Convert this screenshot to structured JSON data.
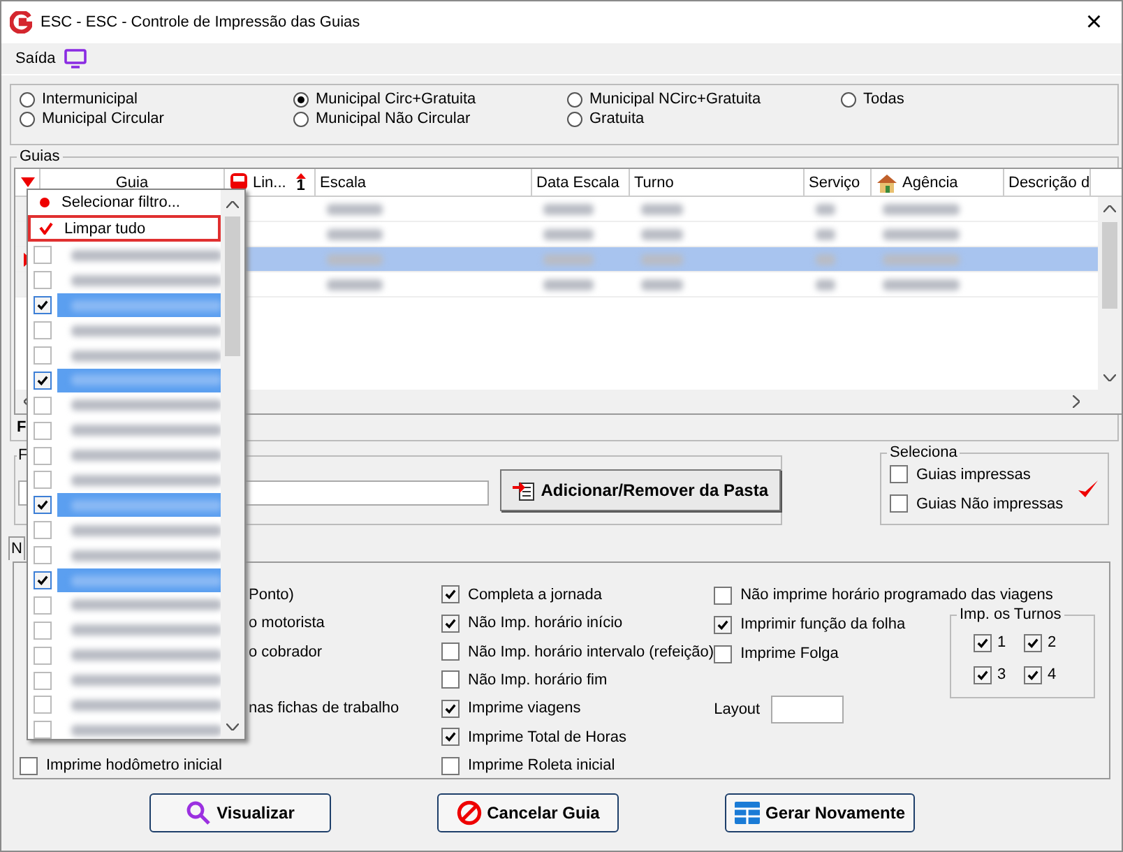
{
  "window": {
    "title": "ESC -  ESC - Controle de Impressão das Guias",
    "close": "×"
  },
  "menu": [
    {
      "label": "Saída",
      "kind": "monitor"
    }
  ],
  "line_types": [
    {
      "label": "Intermunicipal",
      "selected": false
    },
    {
      "label": "Municipal Circular",
      "selected": false
    },
    {
      "label": "Municipal Circ+Gratuita",
      "selected": true
    },
    {
      "label": "Municipal Não Circular",
      "selected": false
    },
    {
      "label": "Municipal NCirc+Gratuita",
      "selected": false
    },
    {
      "label": "Gratuita",
      "selected": false
    },
    {
      "label": "Todas",
      "selected": false
    }
  ],
  "guias": {
    "title": "Guias",
    "columns": [
      {
        "label": "Guia",
        "kind": "text"
      },
      {
        "label": "Lin...",
        "kind": "bus",
        "sort": "1"
      },
      {
        "label": "Escala",
        "kind": "text"
      },
      {
        "label": "Data Escala",
        "kind": "text"
      },
      {
        "label": "Turno",
        "kind": "text"
      },
      {
        "label": "Serviço",
        "kind": "text"
      },
      {
        "label": "Agência",
        "kind": "house"
      },
      {
        "label": "Descrição d",
        "kind": "text"
      }
    ],
    "rows": [
      {
        "selected": false
      },
      {
        "selected": false
      },
      {
        "selected": true
      },
      {
        "selected": false
      }
    ],
    "footer": "F"
  },
  "filter_dropdown": {
    "actions": [
      {
        "label": "Selecionar filtro...",
        "kind": "dot",
        "selected": false
      },
      {
        "label": "Limpar tudo",
        "kind": "check",
        "selected": true
      }
    ],
    "items": [
      {
        "checked": false
      },
      {
        "checked": false
      },
      {
        "checked": true
      },
      {
        "checked": false
      },
      {
        "checked": false
      },
      {
        "checked": true
      },
      {
        "checked": false
      },
      {
        "checked": false
      },
      {
        "checked": false
      },
      {
        "checked": false
      },
      {
        "checked": true
      },
      {
        "checked": false
      },
      {
        "checked": false
      },
      {
        "checked": true
      },
      {
        "checked": false
      },
      {
        "checked": false
      },
      {
        "checked": false
      },
      {
        "checked": false
      },
      {
        "checked": false
      },
      {
        "checked": false
      }
    ]
  },
  "pasta": {
    "legend": "F",
    "button": "Adicionar/Remover da Pasta"
  },
  "seleciona": {
    "legend": "Seleciona",
    "options": [
      {
        "label": "Guias impressas",
        "checked": false
      },
      {
        "label": "Guias Não impressas",
        "checked": false
      }
    ]
  },
  "tab": {
    "label": "N"
  },
  "options": {
    "left": [
      {
        "label": "Ponto)",
        "kind": "partial"
      },
      {
        "label": "o motorista",
        "kind": "partial"
      },
      {
        "label": "o cobrador",
        "kind": "partial"
      },
      {
        "kind": "gap"
      },
      {
        "label": "nas fichas de trabalho",
        "kind": "partial"
      },
      {
        "kind": "gap"
      },
      {
        "label": "Imprime hodômetro inicial",
        "kind": "full",
        "checked": false
      }
    ],
    "middle": [
      {
        "label": "Completa a jornada",
        "checked": true
      },
      {
        "label": "Não Imp. horário início",
        "checked": true
      },
      {
        "label": "Não Imp. horário intervalo (refeição)",
        "checked": false
      },
      {
        "label": "Não Imp. horário fim",
        "checked": false
      },
      {
        "label": "Imprime viagens",
        "checked": true
      },
      {
        "label": "Imprime Total de Horas",
        "checked": true
      },
      {
        "label": "Imprime Roleta inicial",
        "checked": false
      }
    ],
    "right": [
      {
        "label": "Não imprime horário programado das viagens",
        "checked": false
      },
      {
        "label": "Imprimir função da folha",
        "checked": true
      },
      {
        "label": "Imprime Folga",
        "checked": false
      }
    ],
    "layout": {
      "label": "Layout"
    },
    "turnos": {
      "legend": "Imp. os Turnos",
      "items": [
        {
          "label": "1",
          "checked": true
        },
        {
          "label": "2",
          "checked": true
        },
        {
          "label": "3",
          "checked": true
        },
        {
          "label": "4",
          "checked": true
        }
      ]
    }
  },
  "buttons": [
    {
      "label": "Visualizar",
      "kind": "view"
    },
    {
      "label": "Cancelar Guia",
      "kind": "cancel"
    },
    {
      "label": "Gerar Novamente",
      "kind": "grid"
    }
  ]
}
